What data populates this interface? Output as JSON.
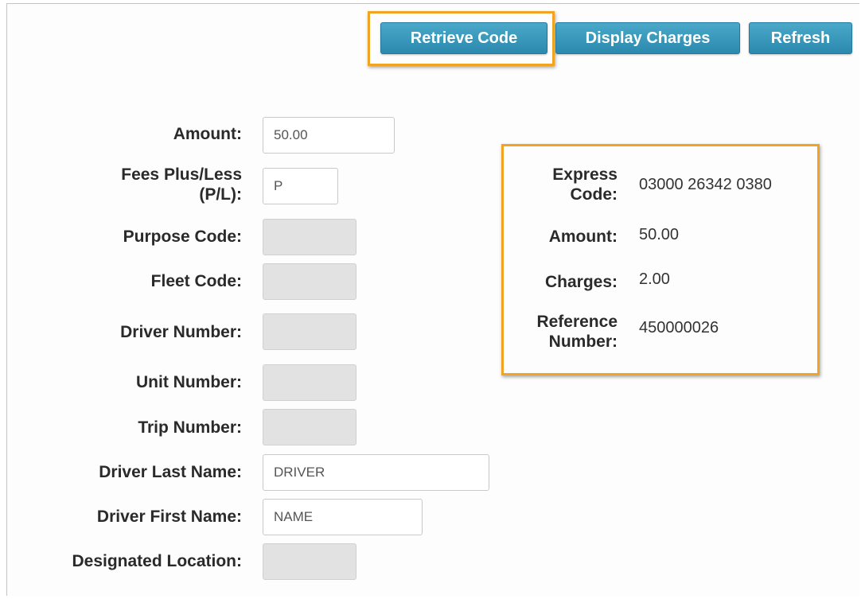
{
  "toolbar": {
    "retrieve_code_label": "Retrieve Code",
    "display_charges_label": "Display Charges",
    "refresh_label": "Refresh"
  },
  "form": {
    "amount": {
      "label": "Amount:",
      "value": "50.00"
    },
    "fees_plus_less": {
      "label_line1": "Fees Plus/Less",
      "label_line2": "(P/L):",
      "value": "P"
    },
    "purpose_code": {
      "label": "Purpose Code:",
      "value": ""
    },
    "fleet_code": {
      "label": "Fleet Code:",
      "value": ""
    },
    "driver_number": {
      "label": "Driver Number:",
      "value": ""
    },
    "unit_number": {
      "label": "Unit Number:",
      "value": ""
    },
    "trip_number": {
      "label": "Trip Number:",
      "value": ""
    },
    "driver_last_name": {
      "label": "Driver Last Name:",
      "value": "DRIVER"
    },
    "driver_first_name": {
      "label": "Driver First Name:",
      "value": "NAME"
    },
    "designated_location": {
      "label": "Designated Location:",
      "value": ""
    }
  },
  "result": {
    "express_code": {
      "label_line1": "Express",
      "label_line2": "Code:",
      "value": "03000 26342 0380"
    },
    "amount": {
      "label": "Amount:",
      "value": "50.00"
    },
    "charges": {
      "label": "Charges:",
      "value": "2.00"
    },
    "reference_number": {
      "label_line1": "Reference",
      "label_line2": "Number:",
      "value": "450000026"
    }
  },
  "colors": {
    "highlight": "#f0a422",
    "button": "#2b89ae",
    "disabled_field": "#e2e2e2"
  }
}
